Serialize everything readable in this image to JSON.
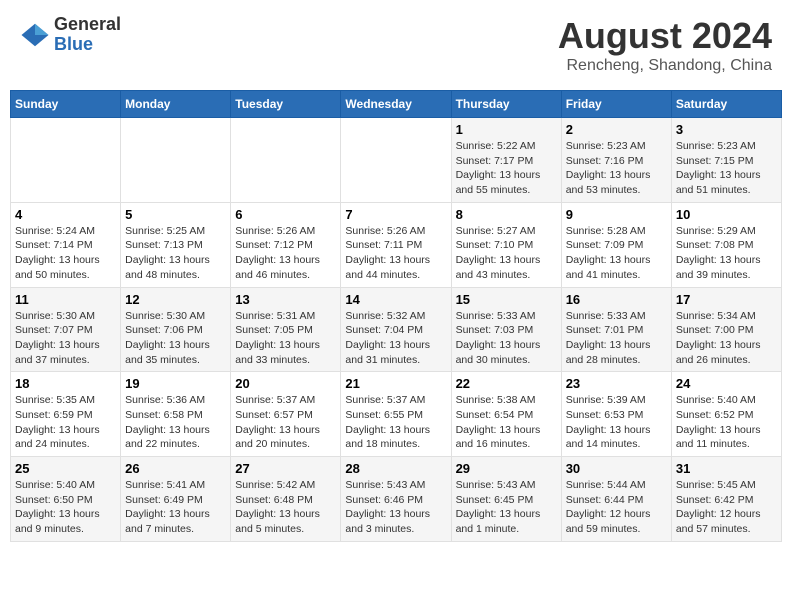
{
  "logo": {
    "general": "General",
    "blue": "Blue"
  },
  "title": "August 2024",
  "subtitle": "Rencheng, Shandong, China",
  "days_of_week": [
    "Sunday",
    "Monday",
    "Tuesday",
    "Wednesday",
    "Thursday",
    "Friday",
    "Saturday"
  ],
  "weeks": [
    [
      {
        "day": "",
        "info": ""
      },
      {
        "day": "",
        "info": ""
      },
      {
        "day": "",
        "info": ""
      },
      {
        "day": "",
        "info": ""
      },
      {
        "day": "1",
        "info": "Sunrise: 5:22 AM\nSunset: 7:17 PM\nDaylight: 13 hours\nand 55 minutes."
      },
      {
        "day": "2",
        "info": "Sunrise: 5:23 AM\nSunset: 7:16 PM\nDaylight: 13 hours\nand 53 minutes."
      },
      {
        "day": "3",
        "info": "Sunrise: 5:23 AM\nSunset: 7:15 PM\nDaylight: 13 hours\nand 51 minutes."
      }
    ],
    [
      {
        "day": "4",
        "info": "Sunrise: 5:24 AM\nSunset: 7:14 PM\nDaylight: 13 hours\nand 50 minutes."
      },
      {
        "day": "5",
        "info": "Sunrise: 5:25 AM\nSunset: 7:13 PM\nDaylight: 13 hours\nand 48 minutes."
      },
      {
        "day": "6",
        "info": "Sunrise: 5:26 AM\nSunset: 7:12 PM\nDaylight: 13 hours\nand 46 minutes."
      },
      {
        "day": "7",
        "info": "Sunrise: 5:26 AM\nSunset: 7:11 PM\nDaylight: 13 hours\nand 44 minutes."
      },
      {
        "day": "8",
        "info": "Sunrise: 5:27 AM\nSunset: 7:10 PM\nDaylight: 13 hours\nand 43 minutes."
      },
      {
        "day": "9",
        "info": "Sunrise: 5:28 AM\nSunset: 7:09 PM\nDaylight: 13 hours\nand 41 minutes."
      },
      {
        "day": "10",
        "info": "Sunrise: 5:29 AM\nSunset: 7:08 PM\nDaylight: 13 hours\nand 39 minutes."
      }
    ],
    [
      {
        "day": "11",
        "info": "Sunrise: 5:30 AM\nSunset: 7:07 PM\nDaylight: 13 hours\nand 37 minutes."
      },
      {
        "day": "12",
        "info": "Sunrise: 5:30 AM\nSunset: 7:06 PM\nDaylight: 13 hours\nand 35 minutes."
      },
      {
        "day": "13",
        "info": "Sunrise: 5:31 AM\nSunset: 7:05 PM\nDaylight: 13 hours\nand 33 minutes."
      },
      {
        "day": "14",
        "info": "Sunrise: 5:32 AM\nSunset: 7:04 PM\nDaylight: 13 hours\nand 31 minutes."
      },
      {
        "day": "15",
        "info": "Sunrise: 5:33 AM\nSunset: 7:03 PM\nDaylight: 13 hours\nand 30 minutes."
      },
      {
        "day": "16",
        "info": "Sunrise: 5:33 AM\nSunset: 7:01 PM\nDaylight: 13 hours\nand 28 minutes."
      },
      {
        "day": "17",
        "info": "Sunrise: 5:34 AM\nSunset: 7:00 PM\nDaylight: 13 hours\nand 26 minutes."
      }
    ],
    [
      {
        "day": "18",
        "info": "Sunrise: 5:35 AM\nSunset: 6:59 PM\nDaylight: 13 hours\nand 24 minutes."
      },
      {
        "day": "19",
        "info": "Sunrise: 5:36 AM\nSunset: 6:58 PM\nDaylight: 13 hours\nand 22 minutes."
      },
      {
        "day": "20",
        "info": "Sunrise: 5:37 AM\nSunset: 6:57 PM\nDaylight: 13 hours\nand 20 minutes."
      },
      {
        "day": "21",
        "info": "Sunrise: 5:37 AM\nSunset: 6:55 PM\nDaylight: 13 hours\nand 18 minutes."
      },
      {
        "day": "22",
        "info": "Sunrise: 5:38 AM\nSunset: 6:54 PM\nDaylight: 13 hours\nand 16 minutes."
      },
      {
        "day": "23",
        "info": "Sunrise: 5:39 AM\nSunset: 6:53 PM\nDaylight: 13 hours\nand 14 minutes."
      },
      {
        "day": "24",
        "info": "Sunrise: 5:40 AM\nSunset: 6:52 PM\nDaylight: 13 hours\nand 11 minutes."
      }
    ],
    [
      {
        "day": "25",
        "info": "Sunrise: 5:40 AM\nSunset: 6:50 PM\nDaylight: 13 hours\nand 9 minutes."
      },
      {
        "day": "26",
        "info": "Sunrise: 5:41 AM\nSunset: 6:49 PM\nDaylight: 13 hours\nand 7 minutes."
      },
      {
        "day": "27",
        "info": "Sunrise: 5:42 AM\nSunset: 6:48 PM\nDaylight: 13 hours\nand 5 minutes."
      },
      {
        "day": "28",
        "info": "Sunrise: 5:43 AM\nSunset: 6:46 PM\nDaylight: 13 hours\nand 3 minutes."
      },
      {
        "day": "29",
        "info": "Sunrise: 5:43 AM\nSunset: 6:45 PM\nDaylight: 13 hours\nand 1 minute."
      },
      {
        "day": "30",
        "info": "Sunrise: 5:44 AM\nSunset: 6:44 PM\nDaylight: 12 hours\nand 59 minutes."
      },
      {
        "day": "31",
        "info": "Sunrise: 5:45 AM\nSunset: 6:42 PM\nDaylight: 12 hours\nand 57 minutes."
      }
    ]
  ]
}
